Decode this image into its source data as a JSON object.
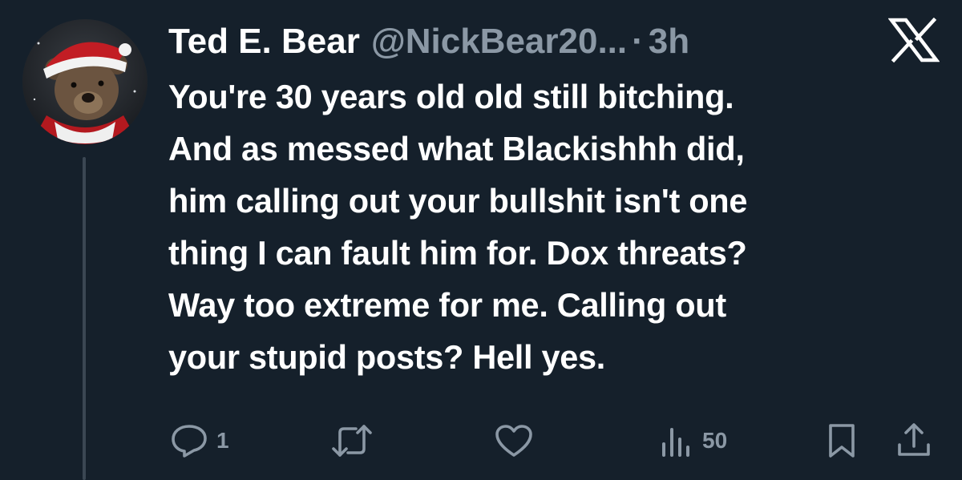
{
  "tweet": {
    "display_name": "Ted E. Bear",
    "handle": "@NickBear20...",
    "separator": "·",
    "time": "3h",
    "text_lines": [
      "You're 30 years old old still bitching.",
      "And as messed what Blackishhh did,",
      "him calling out your bullshit isn't one",
      "thing I can fault him for. Dox threats?",
      "Way too extreme for me. Calling out",
      "your stupid posts? Hell yes."
    ],
    "reply_count": "1",
    "view_count": "50",
    "icons": {
      "avatar": "avatar-bear-santa-hat",
      "brand": "x-logo-icon",
      "reply": "reply-icon",
      "retweet": "retweet-icon",
      "like": "heart-icon",
      "views": "views-chart-icon",
      "bookmark": "bookmark-icon",
      "share": "share-icon"
    }
  },
  "colors": {
    "background": "#15202b",
    "text_primary": "#ffffff",
    "text_secondary": "#8b98a5",
    "thread_line": "#3b4753"
  }
}
